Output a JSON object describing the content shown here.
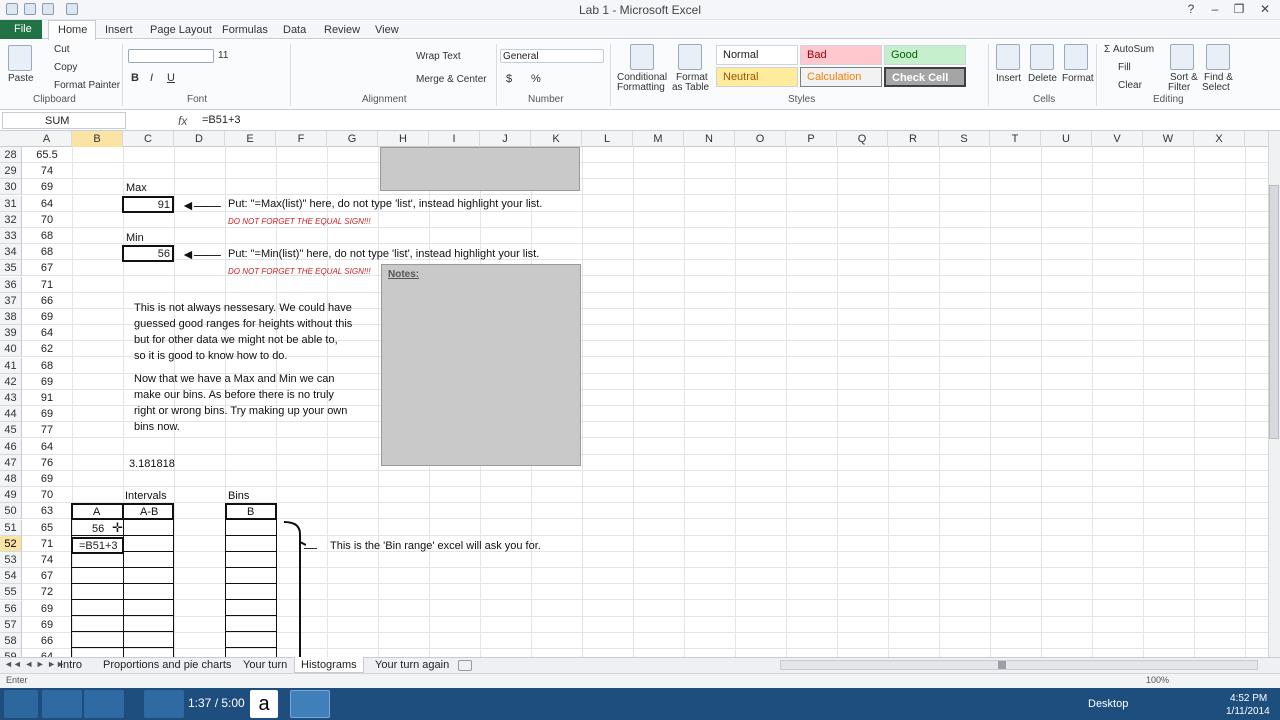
{
  "window": {
    "title": "Lab 1 - Microsoft Excel"
  },
  "tabs": {
    "file": "File",
    "items": [
      "Home",
      "Insert",
      "Page Layout",
      "Formulas",
      "Data",
      "Review",
      "View"
    ]
  },
  "ribbon": {
    "clipboard": {
      "paste": "Paste",
      "cut": "Cut",
      "copy": "Copy",
      "format_painter": "Format Painter",
      "group": "Clipboard"
    },
    "font": {
      "size": "11",
      "group": "Font"
    },
    "alignment": {
      "wrap": "Wrap Text",
      "merge": "Merge & Center",
      "group": "Alignment"
    },
    "number": {
      "format": "General",
      "dollar": "$",
      "percent": "%",
      "group": "Number"
    },
    "styles": {
      "cond1": "Conditional",
      "cond2": "Formatting",
      "fmt1": "Format",
      "fmt2": "as Table",
      "normal": "Normal",
      "bad": "Bad",
      "good": "Good",
      "neutral": "Neutral",
      "calculation": "Calculation",
      "check": "Check Cell",
      "group": "Styles"
    },
    "cells": {
      "insert": "Insert",
      "delete": "Delete",
      "format": "Format",
      "group": "Cells"
    },
    "editing": {
      "autosum": "AutoSum",
      "fill": "Fill",
      "clear": "Clear",
      "sort1": "Sort &",
      "sort2": "Filter",
      "find1": "Find &",
      "find2": "Select",
      "group": "Editing"
    }
  },
  "formula_bar": {
    "name_box": "SUM",
    "fx": "fx",
    "formula": "=B51+3"
  },
  "columns": [
    "A",
    "B",
    "C",
    "D",
    "E",
    "F",
    "G",
    "H",
    "I",
    "J",
    "K",
    "L",
    "M",
    "N",
    "O",
    "P",
    "Q",
    "R",
    "S",
    "T",
    "U",
    "V",
    "W",
    "X"
  ],
  "rows": [
    {
      "n": "28",
      "a": "65.5"
    },
    {
      "n": "29",
      "a": "74"
    },
    {
      "n": "30",
      "a": "69"
    },
    {
      "n": "31",
      "a": "64"
    },
    {
      "n": "32",
      "a": "70"
    },
    {
      "n": "33",
      "a": "68"
    },
    {
      "n": "34",
      "a": "68"
    },
    {
      "n": "35",
      "a": "67"
    },
    {
      "n": "36",
      "a": "71"
    },
    {
      "n": "37",
      "a": "66"
    },
    {
      "n": "38",
      "a": "69"
    },
    {
      "n": "39",
      "a": "64"
    },
    {
      "n": "40",
      "a": "62"
    },
    {
      "n": "41",
      "a": "68"
    },
    {
      "n": "42",
      "a": "69"
    },
    {
      "n": "43",
      "a": "91"
    },
    {
      "n": "44",
      "a": "69"
    },
    {
      "n": "46",
      "a": "64"
    },
    {
      "n": "45",
      "a": "77"
    },
    {
      "n": "47",
      "a": "76"
    },
    {
      "n": "48",
      "a": "69"
    },
    {
      "n": "49",
      "a": "70"
    },
    {
      "n": "50",
      "a": "63"
    },
    {
      "n": "51",
      "a": "65"
    },
    {
      "n": "52",
      "a": "71"
    },
    {
      "n": "53",
      "a": "74"
    },
    {
      "n": "54",
      "a": "67"
    },
    {
      "n": "55",
      "a": "72"
    },
    {
      "n": "56",
      "a": "69"
    },
    {
      "n": "57",
      "a": "69"
    },
    {
      "n": "58",
      "a": "66"
    },
    {
      "n": "59",
      "a": "64"
    }
  ],
  "sheet": {
    "max_label": "Max",
    "max_value": "91",
    "max_instr": "Put: \"=Max(list)\" here, do not type 'list', instead highlight your list.",
    "warning": "DO NOT FORGET THE EQUAL SIGN!!!",
    "min_label": "Min",
    "min_value": "56",
    "min_instr": "Put: \"=Min(list)\" here, do not type 'list', instead highlight your list.",
    "notes": "Notes:",
    "para1": [
      "This is not always nessesary.  We could have",
      "guessed good ranges for heights without this",
      "but for other data we might not be able to,",
      "so it is good to know how to do."
    ],
    "para2": [
      "Now that we have a Max and Min we can",
      "make our bins.  As before there is no truly",
      "right or wrong bins.  Try making up your own",
      "bins now."
    ],
    "value_3181": "3.181818",
    "intervals": "Intervals",
    "bins": "Bins",
    "head_a": "A",
    "head_ab": "A-B",
    "head_b": "B",
    "b51": "56",
    "b52": "=B51+3",
    "bin_note": "This is the 'Bin range' excel will ask you for."
  },
  "sheet_tabs": [
    "Intro",
    "Proportions and pie charts",
    "Your turn",
    "Histograms",
    "Your turn again"
  ],
  "status": {
    "mode": "Enter",
    "zoom": "100%"
  },
  "taskbar": {
    "desktop": "Desktop",
    "time": "4:52 PM",
    "date": "1/11/2014",
    "media": "1:37 / 5:00"
  }
}
